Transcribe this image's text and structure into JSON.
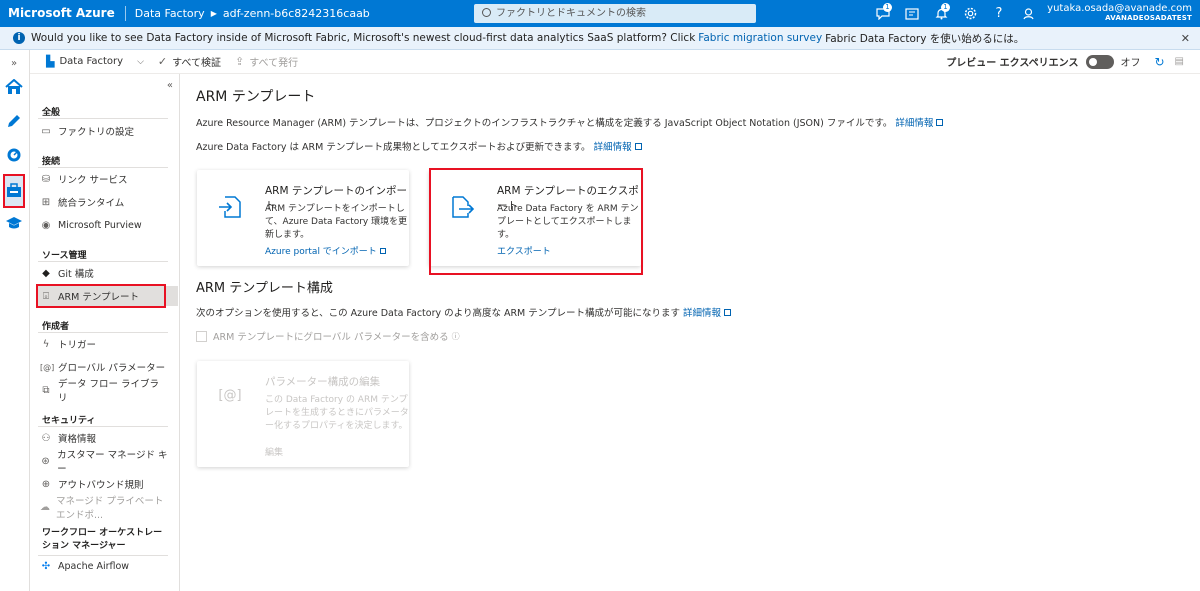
{
  "topbar": {
    "brand": "Microsoft Azure",
    "crumb1": "Data Factory",
    "crumb2": "adf-zenn-b6c8242316caab",
    "search_placeholder": "ファクトリとドキュメントの検索",
    "badge1": "1",
    "badge2": "1",
    "user_name": "yutaka.osada@avanade.com",
    "tenant": "AVANADEOSADATEST",
    "icons": [
      "chat-bubble-icon",
      "switch-directory-icon",
      "bell-icon",
      "gear-icon",
      "help-icon",
      "feedback-icon"
    ]
  },
  "banner": {
    "text": "Would you like to see Data Factory inside of Microsoft Fabric, Microsoft's newest cloud-first data analytics SaaS platform? Click ",
    "link": "Fabric migration survey",
    "tail": " Fabric Data Factory を使い始めるには。"
  },
  "toolbar": {
    "factory": "Data Factory",
    "validate": "すべて検証",
    "publish": "すべて発行",
    "preview": "プレビュー エクスペリエンス",
    "toggle_state": "オフ"
  },
  "sidenav": {
    "sec_general": "全般",
    "factory_settings": "ファクトリの設定",
    "sec_connections": "接続",
    "linked_services": "リンク サービス",
    "integration_runtimes": "統合ランタイム",
    "purview": "Microsoft Purview",
    "sec_source": "ソース管理",
    "git": "Git 構成",
    "arm": "ARM テンプレート",
    "sec_author": "作成者",
    "triggers": "トリガー",
    "global_params": "グローバル パラメーター",
    "dataflow_libs": "データ フロー ライブラリ",
    "sec_security": "セキュリティ",
    "credentials": "資格情報",
    "cmk": "カスタマー マネージド キー",
    "outbound": "アウトバウンド規則",
    "private_endpoints": "マネージド プライベート エンドポ...",
    "sec_workflow": "ワークフロー オーケストレーション マネージャー",
    "airflow": "Apache Airflow"
  },
  "main": {
    "title": "ARM テンプレート",
    "desc1": "Azure Resource Manager (ARM) テンプレートは、プロジェクトのインフラストラクチャと構成を定義する JavaScript Object Notation (JSON) ファイルです。",
    "desc1_link": "詳細情報",
    "desc2": "Azure Data Factory は ARM テンプレート成果物としてエクスポートおよび更新できます。",
    "desc2_link": "詳細情報",
    "import_title": "ARM テンプレートのインポート",
    "import_desc": "ARM テンプレートをインポートして、Azure Data Factory 環境を更新します。",
    "import_link": "Azure portal でインポート",
    "export_title": "ARM テンプレートのエクスポート",
    "export_desc": "Azure Data Factory を ARM テンプレートとしてエクスポートします。",
    "export_link": "エクスポート",
    "config_title": "ARM テンプレート構成",
    "config_desc": "次のオプションを使用すると、この Azure Data Factory のより高度な ARM テンプレート構成が可能になります",
    "config_link": "詳細情報",
    "checkbox_label": "ARM テンプレートにグローバル パラメーターを含める",
    "param_title": "パラメーター構成の編集",
    "param_desc": "この Data Factory の ARM テンプレートを生成するときにパラメーター化するプロパティを決定します。",
    "param_link": "編集"
  },
  "colors": {
    "accent": "#0078d4",
    "highlight": "#e81123"
  }
}
